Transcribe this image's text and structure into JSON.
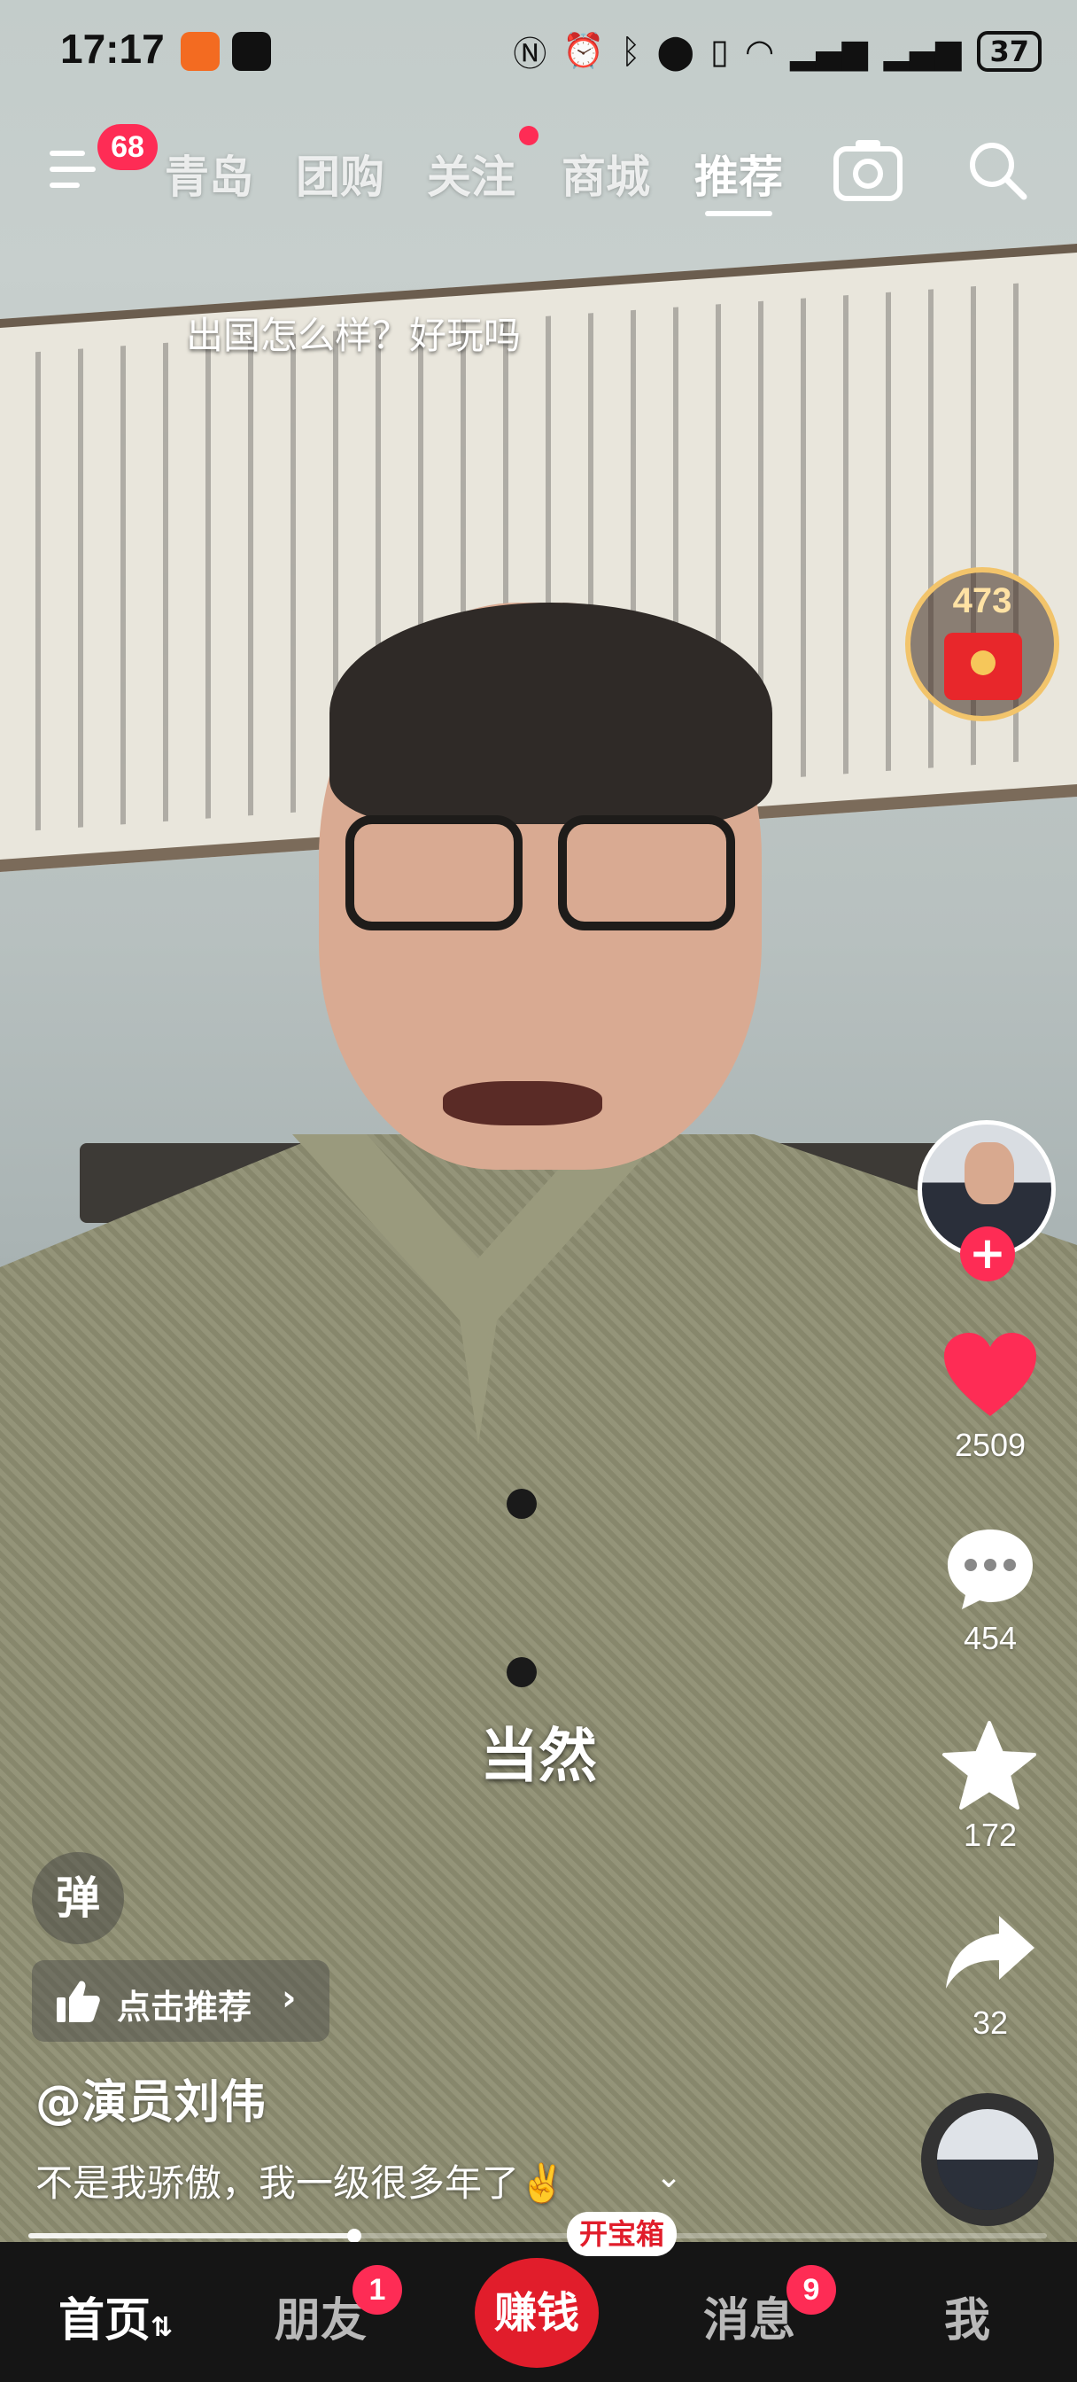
{
  "status_bar": {
    "time": "17:17",
    "battery": "37"
  },
  "top_nav": {
    "menu_badge": "68",
    "tabs": [
      "青岛",
      "团购",
      "关注",
      "商城",
      "推荐"
    ],
    "active_tab": "推荐"
  },
  "video": {
    "danmu_comment": "出国怎么样？好玩吗",
    "subtitle": "当然"
  },
  "right_rail": {
    "red_packet_count": "473",
    "likes": "2509",
    "comments": "454",
    "favorites": "172",
    "shares": "32"
  },
  "left_overlay": {
    "danmu_toggle": "弹",
    "recommend_label": "点击推荐",
    "author": "@演员刘伟",
    "caption": "不是我骄傲，我一级很多年了✌️"
  },
  "playback": {
    "progress": 0.32
  },
  "bottom_nav": {
    "home": "首页",
    "friends": "朋友",
    "friends_badge": "1",
    "earn": "赚钱",
    "earn_tag": "开宝箱",
    "messages": "消息",
    "messages_badge": "9",
    "me": "我"
  },
  "colors": {
    "accent": "#fe2c55",
    "earn": "#e11d2b",
    "like": "#fe2c55"
  }
}
